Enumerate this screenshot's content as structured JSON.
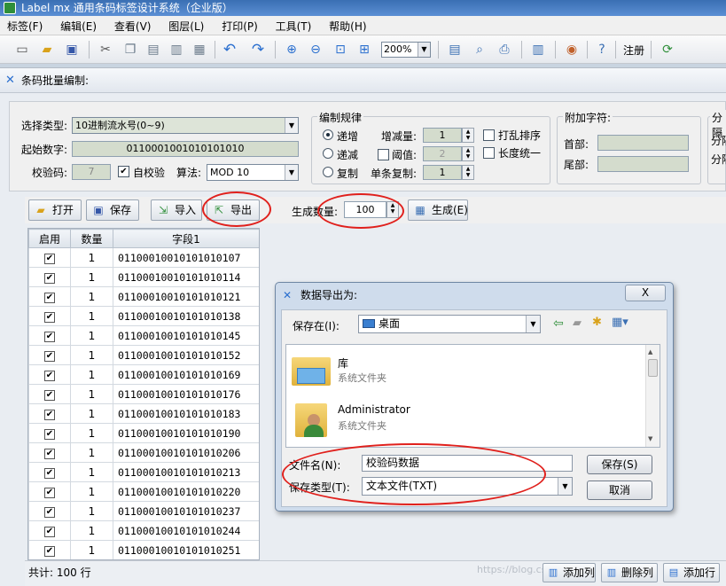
{
  "app": {
    "title": "Label mx 通用条码标签设计系统（企业版）"
  },
  "menu": [
    "标签(F)",
    "编辑(E)",
    "查看(V)",
    "图层(L)",
    "打印(P)",
    "工具(T)",
    "帮助(H)"
  ],
  "toolbar": {
    "zoom": "200%",
    "register_label": "注册"
  },
  "panel": {
    "title": "条码批量编制:"
  },
  "settings": {
    "type_label": "选择类型:",
    "type_value": "10进制流水号(0~9)",
    "start_label": "起始数字:",
    "start_value": "0110001001010101010",
    "check_label": "校验码:",
    "check_value": "7",
    "auto_check_label": "自校验",
    "auto_check_checked": true,
    "algo_label": "算法:",
    "algo_value": "MOD 10",
    "rule_group": "编制规律",
    "rule_inc": "递增",
    "rule_dec": "递减",
    "rule_copy": "复制",
    "rule_selected": "递增",
    "step_label": "增减量:",
    "step_value": "1",
    "threshold_label": "阈值:",
    "threshold_value": "2",
    "copy_label": "单条复制:",
    "copy_value": "1",
    "shuffle_label": "打乱排序",
    "length_label": "长度统一",
    "extra_group": "附加字符:",
    "prefix_label": "首部:",
    "suffix_label": "尾部:",
    "split_group": "分隔",
    "split_a": "分隔",
    "split_b": "分隔"
  },
  "actions": {
    "open": "打开",
    "save": "保存",
    "import": "导入",
    "export": "导出",
    "count_label": "生成数量:",
    "count_value": "100",
    "generate": "生成(E)"
  },
  "grid": {
    "headers": [
      "启用",
      "数量",
      "字段1"
    ],
    "rows": [
      {
        "enabled": true,
        "qty": "1",
        "code": "01100010010101010107"
      },
      {
        "enabled": true,
        "qty": "1",
        "code": "01100010010101010114"
      },
      {
        "enabled": true,
        "qty": "1",
        "code": "01100010010101010121"
      },
      {
        "enabled": true,
        "qty": "1",
        "code": "01100010010101010138"
      },
      {
        "enabled": true,
        "qty": "1",
        "code": "01100010010101010145"
      },
      {
        "enabled": true,
        "qty": "1",
        "code": "01100010010101010152"
      },
      {
        "enabled": true,
        "qty": "1",
        "code": "01100010010101010169"
      },
      {
        "enabled": true,
        "qty": "1",
        "code": "01100010010101010176"
      },
      {
        "enabled": true,
        "qty": "1",
        "code": "01100010010101010183"
      },
      {
        "enabled": true,
        "qty": "1",
        "code": "01100010010101010190"
      },
      {
        "enabled": true,
        "qty": "1",
        "code": "01100010010101010206"
      },
      {
        "enabled": true,
        "qty": "1",
        "code": "01100010010101010213"
      },
      {
        "enabled": true,
        "qty": "1",
        "code": "01100010010101010220"
      },
      {
        "enabled": true,
        "qty": "1",
        "code": "01100010010101010237"
      },
      {
        "enabled": true,
        "qty": "1",
        "code": "01100010010101010244"
      },
      {
        "enabled": true,
        "qty": "1",
        "code": "01100010010101010251"
      }
    ]
  },
  "status": {
    "total": "共计: 100 行",
    "add_col": "添加列",
    "del_col": "删除列",
    "add_row": "添加行",
    "watermark": "https://blog.csdn.net/..."
  },
  "dialog": {
    "title": "数据导出为:",
    "close_label": "X",
    "save_in_label": "保存在(I):",
    "save_in_value": "桌面",
    "items": [
      {
        "name": "库",
        "sub": "系统文件夹",
        "icon": "library-icon"
      },
      {
        "name": "Administrator",
        "sub": "系统文件夹",
        "icon": "user-folder-icon"
      }
    ],
    "filename_label": "文件名(N):",
    "filename_value": "校验码数据",
    "filetype_label": "保存类型(T):",
    "filetype_value": "文本文件(TXT)",
    "save_button": "保存(S)",
    "cancel_button": "取消"
  },
  "colors": {
    "annotation": "#e0201c",
    "accent": "#2a6fcf"
  }
}
